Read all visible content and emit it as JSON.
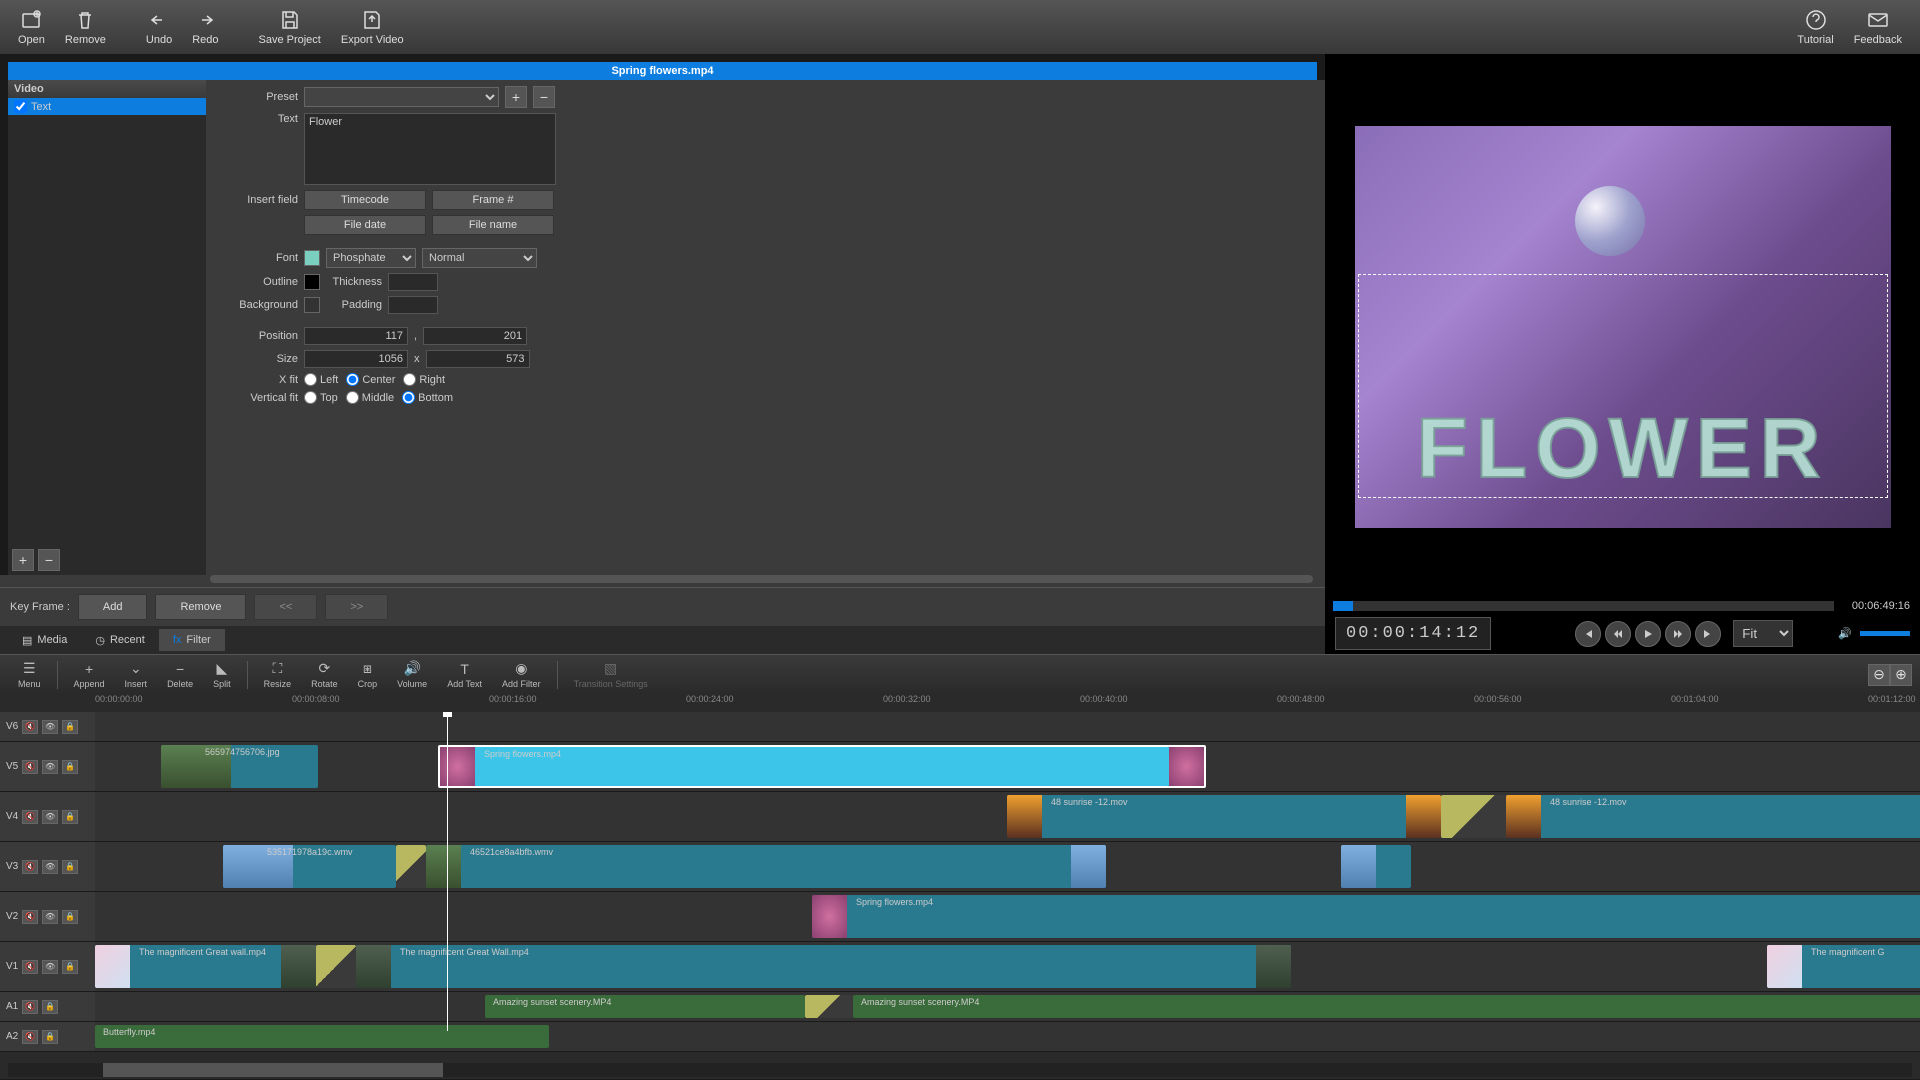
{
  "toolbar": {
    "open": "Open",
    "remove": "Remove",
    "undo": "Undo",
    "redo": "Redo",
    "save": "Save Project",
    "export": "Export Video",
    "tutorial": "Tutorial",
    "feedback": "Feedback"
  },
  "clip_title": "Spring flowers.mp4",
  "fx_tree": {
    "root": "Video",
    "item": "Text"
  },
  "text_fx": {
    "preset_label": "Preset",
    "text_label": "Text",
    "text_value": "Flower",
    "insert_label": "Insert field",
    "btn_timecode": "Timecode",
    "btn_frame": "Frame #",
    "btn_filedate": "File date",
    "btn_filename": "File name",
    "font_label": "Font",
    "font_name": "Phosphate",
    "font_style": "Normal",
    "outline_label": "Outline",
    "thickness_label": "Thickness",
    "background_label": "Background",
    "padding_label": "Padding",
    "position_label": "Position",
    "pos_x": "117",
    "pos_y": "201",
    "size_label": "Size",
    "size_w": "1056",
    "size_h": "573",
    "xfit_label": "X fit",
    "left": "Left",
    "center": "Center",
    "right": "Right",
    "vfit_label": "Vertical fit",
    "top": "Top",
    "middle": "Middle",
    "bottom": "Bottom"
  },
  "keyframe": {
    "label": "Key Frame :",
    "add": "Add",
    "remove": "Remove",
    "prev": "<<",
    "next": ">>"
  },
  "tabs": {
    "media": "Media",
    "recent": "Recent",
    "filter": "Filter"
  },
  "preview": {
    "overlay_text": "FLOWER",
    "duration": "00:06:49:16",
    "timecode": "00:00:14:12",
    "zoom": "Fit"
  },
  "tl_toolbar": {
    "menu": "Menu",
    "append": "Append",
    "insert": "Insert",
    "delete": "Delete",
    "split": "Split",
    "resize": "Resize",
    "rotate": "Rotate",
    "crop": "Crop",
    "volume": "Volume",
    "addtext": "Add Text",
    "addfilter": "Add Filter",
    "transition": "Transition Settings"
  },
  "ruler": [
    "00:00:00:00",
    "00:00:08:00",
    "00:00:16:00",
    "00:00:24:00",
    "00:00:32:00",
    "00:00:40:00",
    "00:00:48:00",
    "00:00:56:00",
    "00:01:04:00",
    "00:01:12:00"
  ],
  "tracks": [
    "V6",
    "V5",
    "V4",
    "V3",
    "V2",
    "V1",
    "A1",
    "A2"
  ],
  "clips": {
    "v5a": "565974756706.jpg",
    "v5b": "Spring flowers.mp4",
    "v4a": "48 sunrise -12.mov",
    "v4b": "48 sunrise -12.mov",
    "v3a": "535171978a19c.wmv",
    "v3b": "46521ce8a4bfb.wmv",
    "v2a": "Spring flowers.mp4",
    "v1a": "The magnificent Great wall.mp4",
    "v1b": "The magnificent Great Wall.mp4",
    "v1c": "The magnificent G",
    "a1a": "Amazing sunset scenery.MP4",
    "a1b": "Amazing sunset scenery.MP4",
    "a2a": "Butterfly.mp4"
  }
}
